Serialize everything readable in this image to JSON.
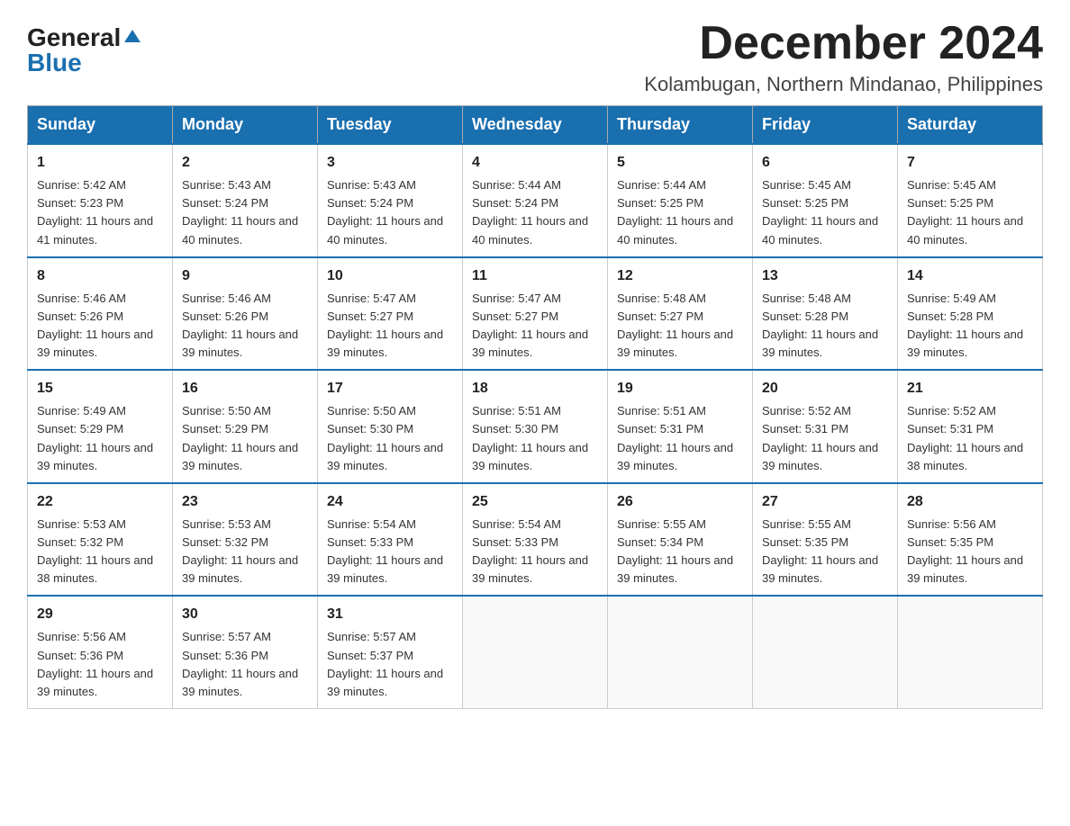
{
  "logo": {
    "general": "General",
    "blue": "Blue"
  },
  "title": "December 2024",
  "location": "Kolambugan, Northern Mindanao, Philippines",
  "weekdays": [
    "Sunday",
    "Monday",
    "Tuesday",
    "Wednesday",
    "Thursday",
    "Friday",
    "Saturday"
  ],
  "weeks": [
    [
      {
        "day": "1",
        "sunrise": "5:42 AM",
        "sunset": "5:23 PM",
        "daylight": "11 hours and 41 minutes."
      },
      {
        "day": "2",
        "sunrise": "5:43 AM",
        "sunset": "5:24 PM",
        "daylight": "11 hours and 40 minutes."
      },
      {
        "day": "3",
        "sunrise": "5:43 AM",
        "sunset": "5:24 PM",
        "daylight": "11 hours and 40 minutes."
      },
      {
        "day": "4",
        "sunrise": "5:44 AM",
        "sunset": "5:24 PM",
        "daylight": "11 hours and 40 minutes."
      },
      {
        "day": "5",
        "sunrise": "5:44 AM",
        "sunset": "5:25 PM",
        "daylight": "11 hours and 40 minutes."
      },
      {
        "day": "6",
        "sunrise": "5:45 AM",
        "sunset": "5:25 PM",
        "daylight": "11 hours and 40 minutes."
      },
      {
        "day": "7",
        "sunrise": "5:45 AM",
        "sunset": "5:25 PM",
        "daylight": "11 hours and 40 minutes."
      }
    ],
    [
      {
        "day": "8",
        "sunrise": "5:46 AM",
        "sunset": "5:26 PM",
        "daylight": "11 hours and 39 minutes."
      },
      {
        "day": "9",
        "sunrise": "5:46 AM",
        "sunset": "5:26 PM",
        "daylight": "11 hours and 39 minutes."
      },
      {
        "day": "10",
        "sunrise": "5:47 AM",
        "sunset": "5:27 PM",
        "daylight": "11 hours and 39 minutes."
      },
      {
        "day": "11",
        "sunrise": "5:47 AM",
        "sunset": "5:27 PM",
        "daylight": "11 hours and 39 minutes."
      },
      {
        "day": "12",
        "sunrise": "5:48 AM",
        "sunset": "5:27 PM",
        "daylight": "11 hours and 39 minutes."
      },
      {
        "day": "13",
        "sunrise": "5:48 AM",
        "sunset": "5:28 PM",
        "daylight": "11 hours and 39 minutes."
      },
      {
        "day": "14",
        "sunrise": "5:49 AM",
        "sunset": "5:28 PM",
        "daylight": "11 hours and 39 minutes."
      }
    ],
    [
      {
        "day": "15",
        "sunrise": "5:49 AM",
        "sunset": "5:29 PM",
        "daylight": "11 hours and 39 minutes."
      },
      {
        "day": "16",
        "sunrise": "5:50 AM",
        "sunset": "5:29 PM",
        "daylight": "11 hours and 39 minutes."
      },
      {
        "day": "17",
        "sunrise": "5:50 AM",
        "sunset": "5:30 PM",
        "daylight": "11 hours and 39 minutes."
      },
      {
        "day": "18",
        "sunrise": "5:51 AM",
        "sunset": "5:30 PM",
        "daylight": "11 hours and 39 minutes."
      },
      {
        "day": "19",
        "sunrise": "5:51 AM",
        "sunset": "5:31 PM",
        "daylight": "11 hours and 39 minutes."
      },
      {
        "day": "20",
        "sunrise": "5:52 AM",
        "sunset": "5:31 PM",
        "daylight": "11 hours and 39 minutes."
      },
      {
        "day": "21",
        "sunrise": "5:52 AM",
        "sunset": "5:31 PM",
        "daylight": "11 hours and 38 minutes."
      }
    ],
    [
      {
        "day": "22",
        "sunrise": "5:53 AM",
        "sunset": "5:32 PM",
        "daylight": "11 hours and 38 minutes."
      },
      {
        "day": "23",
        "sunrise": "5:53 AM",
        "sunset": "5:32 PM",
        "daylight": "11 hours and 39 minutes."
      },
      {
        "day": "24",
        "sunrise": "5:54 AM",
        "sunset": "5:33 PM",
        "daylight": "11 hours and 39 minutes."
      },
      {
        "day": "25",
        "sunrise": "5:54 AM",
        "sunset": "5:33 PM",
        "daylight": "11 hours and 39 minutes."
      },
      {
        "day": "26",
        "sunrise": "5:55 AM",
        "sunset": "5:34 PM",
        "daylight": "11 hours and 39 minutes."
      },
      {
        "day": "27",
        "sunrise": "5:55 AM",
        "sunset": "5:35 PM",
        "daylight": "11 hours and 39 minutes."
      },
      {
        "day": "28",
        "sunrise": "5:56 AM",
        "sunset": "5:35 PM",
        "daylight": "11 hours and 39 minutes."
      }
    ],
    [
      {
        "day": "29",
        "sunrise": "5:56 AM",
        "sunset": "5:36 PM",
        "daylight": "11 hours and 39 minutes."
      },
      {
        "day": "30",
        "sunrise": "5:57 AM",
        "sunset": "5:36 PM",
        "daylight": "11 hours and 39 minutes."
      },
      {
        "day": "31",
        "sunrise": "5:57 AM",
        "sunset": "5:37 PM",
        "daylight": "11 hours and 39 minutes."
      },
      null,
      null,
      null,
      null
    ]
  ],
  "labels": {
    "sunrise": "Sunrise:",
    "sunset": "Sunset:",
    "daylight": "Daylight:"
  }
}
